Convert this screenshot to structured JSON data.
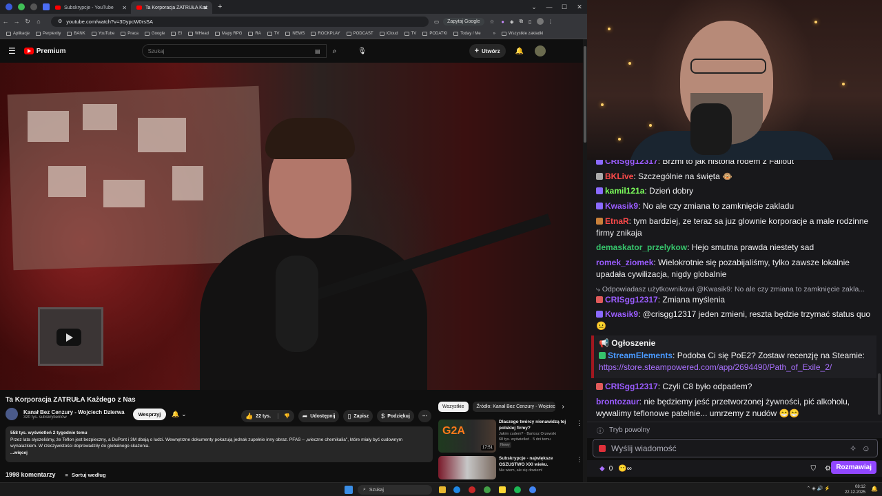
{
  "browser": {
    "tabs": [
      {
        "title": "Subskrypcje - YouTube"
      },
      {
        "title": "Ta Korporacja ZATRUŁA Każ"
      }
    ],
    "url": "youtube.com/watch?v=3DypcW0rsSA",
    "ask_google": "Zapytaj Google",
    "bookmarks": [
      "Aplikacje",
      "Perplexity",
      "BANK",
      "YouTube",
      "Praca",
      "Google",
      "EI",
      "WHead",
      "Mapy RPG",
      "RA",
      "TV",
      "NEWS",
      "ROCKPLAY",
      "PODCAST",
      "iCloud",
      "TV",
      "PODATKI",
      "Today / Me"
    ],
    "all_bookmarks": "Wszystkie zakładki"
  },
  "youtube": {
    "logo": "Premium",
    "search_placeholder": "Szukaj",
    "create": "Utwórz",
    "video_title": "Ta Korporacja ZATRUŁA Każdego z Nas",
    "channel_name": "Kanał Bez Cenzury - Wojciech Dzierwa",
    "subscribers": "320 tys. subskrybentów",
    "support": "Wesprzyj",
    "likes": "22 tys.",
    "share": "Udostępnij",
    "save": "Zapisz",
    "thanks": "Podziękuj",
    "desc_meta": "558 tys. wyświetleń  2 tygodnie temu",
    "description": "Przez lata słyszeliśmy, że Teflon jest bezpieczny, a DuPont i 3M dbają o ludzi. Wewnętrzne dokumenty pokazują jednak zupełnie inny obraz. PFAS – „wieczne chemikalia\", które miały być cudownym wynalazkiem. W rzeczywistości doprowadziły do globalnego skażenia.",
    "more": "...więcej",
    "comments_count": "1998 komentarzy",
    "sort_by": "Sortuj według",
    "chips": [
      "Wszystkie",
      "Źródło: Kanał Bez Cenzury - Wojciech"
    ],
    "recommendations": [
      {
        "title": "Dlaczego twórcy nienawidzą tej polskiej firmy?",
        "channel": "Jakim cudem? · Bartosz Orzewski",
        "meta": "68 tys. wyświetleń · 5 dni temu",
        "badge": "Nowy",
        "duration": "17:51",
        "thumb_text": "G2A"
      },
      {
        "title": "Subskrypcje - największe OSZUSTWO XXI wieku.",
        "channel": "Nie wiem, ale się dowiem!",
        "meta": "",
        "badge": "",
        "duration": "",
        "thumb_text": ""
      }
    ]
  },
  "chat": {
    "messages": [
      {
        "user": "CRISgg12317",
        "text": ": Brzmi to jak historia rodem z Fallout",
        "color": "#9a5cff"
      },
      {
        "user": "BKLive",
        "text": ": Szczególnie na święta",
        "color": "#ff4a4a"
      },
      {
        "user": "kamil121a",
        "text": ": Dzień dobry",
        "color": "#7cff5c"
      },
      {
        "user": "Kwasik9",
        "text": ": No ale czy zmiana to zamknięcie zakladu",
        "color": "#9a5cff"
      },
      {
        "user": "EtnaR",
        "text": ": tym bardziej, ze teraz sa juz glownie korporacje a male rodzinne firmy znikaja",
        "color": "#ff4a4a"
      },
      {
        "user": "demaskator_przelykow",
        "text": ": Hejo smutna prawda niestety sad",
        "color": "#36c36b"
      },
      {
        "user": "romek_ziomek",
        "text": ": Wielokrotnie się pozabijaliśmy, tylko zawsze lokalnie upadała cywilizacja, nigdy globalnie",
        "color": "#9a5cff"
      },
      {
        "user": "CRISgg12317",
        "text": ": Zmiana myślenia",
        "color": "#9a5cff"
      },
      {
        "user": "Kwasik9",
        "text": ": @crisgg12317 jeden zmieni, reszta będzie trzymać status quo",
        "color": "#9a5cff"
      },
      {
        "user": "StreamElements",
        "text": ": Podoba Ci się PoE2? Zostaw recenzję na Steamie: ",
        "color": "#4a9aff"
      },
      {
        "user": "CRISgg12317",
        "text": ": Czyli C8 było odpadem?",
        "color": "#9a5cff"
      },
      {
        "user": "brontozaur",
        "text": ": nie będziemy jeść przetworzonej żywności, pić alkoholu, wywalimy teflonowe patelnie... umrzemy z nudów",
        "color": "#9a5cff"
      }
    ],
    "reply_to": "Odpowiadasz użytkownikowi @Kwasik9: No ale czy zmiana to zamknięcie zakla...",
    "announcement": "Ogłoszenie",
    "announce_link": "https://store.steampowered.com/app/2694490/Path_of_Exile_2/",
    "slow_mode": "Tryb powolny",
    "input_placeholder": "Wyślij wiadomość",
    "points": "0",
    "chat_button": "Rozmawiaj"
  },
  "taskbar": {
    "search": "Szukaj",
    "time": "08:12",
    "date": "22.12.2025"
  }
}
